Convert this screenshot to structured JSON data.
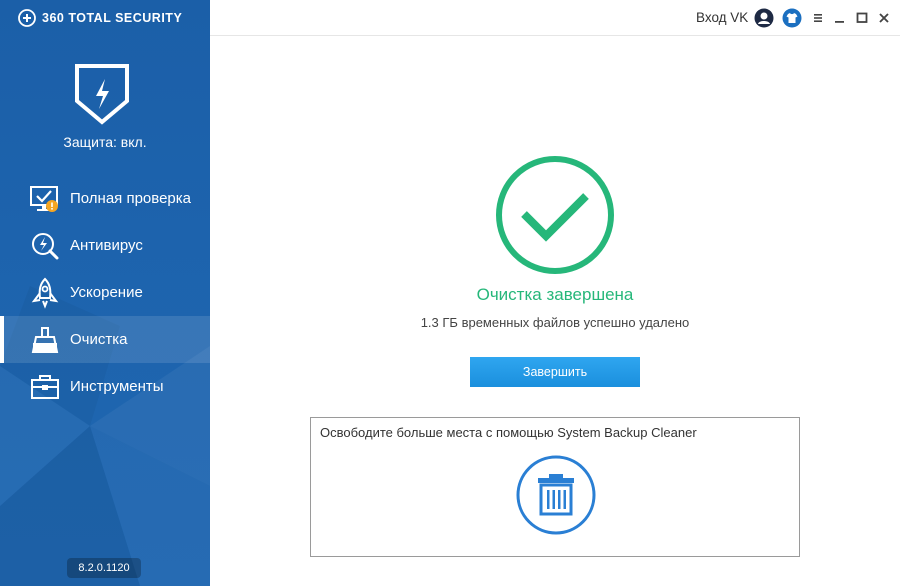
{
  "brand": {
    "name": "360 TOTAL SECURITY"
  },
  "sidebar": {
    "protection_label": "Защита: вкл.",
    "items": [
      {
        "label": "Полная проверка",
        "icon": "monitor-check-icon",
        "active": false
      },
      {
        "label": "Антивирус",
        "icon": "antivirus-search-icon",
        "active": false
      },
      {
        "label": "Ускорение",
        "icon": "rocket-icon",
        "active": false
      },
      {
        "label": "Очистка",
        "icon": "broom-icon",
        "active": true
      },
      {
        "label": "Инструменты",
        "icon": "toolbox-icon",
        "active": false
      }
    ],
    "version": "8.2.0.1120"
  },
  "titlebar": {
    "login_label": "Вход VK"
  },
  "main": {
    "status_title": "Очистка завершена",
    "status_subtitle": "1.3 ГБ временных файлов успешно удалено",
    "finish_label": "Завершить",
    "promo_text": "Освободите больше места с помощью System Backup Cleaner"
  },
  "colors": {
    "sidebar_blue": "#1d63ad",
    "success_green": "#26b77a",
    "button_blue": "#1b8fdd",
    "warning_orange": "#f5a623"
  }
}
